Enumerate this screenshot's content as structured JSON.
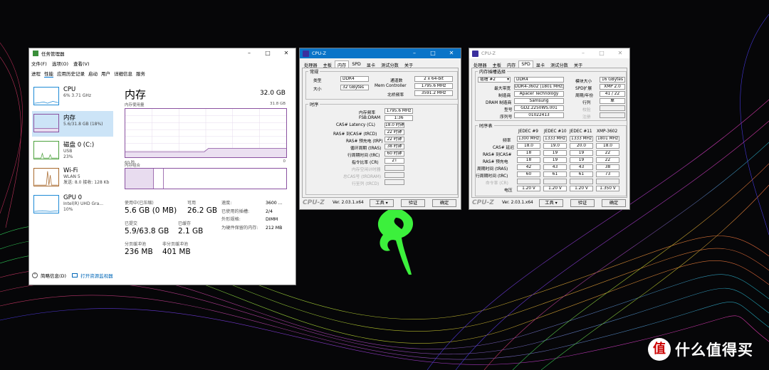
{
  "colors": {
    "mem_purple": "#8b52a1",
    "cpuz_blue": "#0a74c8",
    "select_blue": "#cce4f7"
  },
  "tm": {
    "title": "任务管理器",
    "menu": [
      "文件(F)",
      "选项(O)",
      "查看(V)"
    ],
    "tabs": [
      "进程",
      "性能",
      "应用历史记录",
      "启动",
      "用户",
      "详细信息",
      "服务"
    ],
    "side": [
      {
        "t": "CPU",
        "d1": "6%  3.71 GHz",
        "d2": ""
      },
      {
        "t": "内存",
        "d1": "5.6/31.8 GB (18%)",
        "d2": ""
      },
      {
        "t": "磁盘 0 (C:)",
        "d1": "USB",
        "d2": "23%"
      },
      {
        "t": "Wi-Fi",
        "d1": "WLAN 5",
        "d2": "发送: 8.0  接收: 128 Kb"
      },
      {
        "t": "GPU 0",
        "d1": "Intel(R) UHD Gra...",
        "d2": "10%"
      }
    ],
    "main": {
      "title": "内存",
      "total": "32.0 GB",
      "usage_label": "内存使用量",
      "usage_max": "31.8 GB",
      "axis_left": "60 秒",
      "axis_right": "0",
      "comp_label": "内存组合"
    },
    "stats": {
      "inuse_l": "使用中(已压缩)",
      "inuse_v": "5.6 GB (0 MB)",
      "avail_l": "可用",
      "avail_v": "26.2 GB",
      "commit_l": "已提交",
      "commit_v": "5.9/63.8 GB",
      "cache_l": "已缓存",
      "cache_v": "2.1 GB",
      "paged_l": "分页缓冲池",
      "paged_v": "236 MB",
      "np_l": "非分页缓冲池",
      "np_v": "401 MB"
    },
    "kv": [
      [
        "速度:",
        "3600 ..."
      ],
      [
        "已使用的插槽:",
        "2/4"
      ],
      [
        "外形规格:",
        "DIMM"
      ],
      [
        "为硬件保留的内存:",
        "212 MB"
      ]
    ],
    "footer": {
      "brief": "简略信息(D)",
      "open": "打开资源监视器"
    }
  },
  "cz1": {
    "title": "CPU-Z",
    "tabs": [
      "处理器",
      "主板",
      "内存",
      "SPD",
      "显卡",
      "测试分数",
      "关于"
    ],
    "general": "常规",
    "type_l": "类型",
    "type_v": "DDR4",
    "size_l": "大小",
    "size_v": "32 GBytes",
    "ch_l": "通道数",
    "ch_v": "2 x 64-bit",
    "mc_l": "Mem Controller",
    "mc_v": "1795.6 MHz",
    "nb_l": "北桥频率",
    "nb_v": "3591.2 MHz",
    "timing": "时序",
    "rows": [
      [
        "内存频率",
        "1795.6 MHz"
      ],
      [
        "FSB:DRAM",
        "1:36"
      ],
      [
        "CAS# Latency (CL)",
        "18.0 时钟"
      ],
      [
        "RAS# 到CAS# (tRCD)",
        "22 时钟"
      ],
      [
        "RAS# 预充电 (tRP)",
        "22 时钟"
      ],
      [
        "循环周期 (tRAS)",
        "38 时钟"
      ],
      [
        "行周期时间 (tRC)",
        "60 时钟"
      ],
      [
        "指令比率 (CR)",
        "2T"
      ]
    ],
    "gray": [
      "内存空闲计时器",
      "总CAS号 (tRDRAM)",
      "行至列 (tRCD)"
    ],
    "brand": "CPU-Z",
    "ver": "Ver. 2.03.1.x64",
    "tools": "工具",
    "verify": "验证",
    "ok": "确定"
  },
  "cz2": {
    "title": "CPU-Z",
    "tabs": [
      "处理器",
      "主板",
      "内存",
      "SPD",
      "显卡",
      "测试分数",
      "关于"
    ],
    "slotsel": "内存插槽选择",
    "slot": "插槽 #2",
    "slot_type": "DDR4",
    "modsize_l": "模块大小",
    "modsize_v": "16 GBytes",
    "maxbw_l": "最大带宽",
    "maxbw_v": "DDR4-3602 (1801 MHz)",
    "spd_l": "SPD扩展",
    "spd_v": "XMP 2.0",
    "mfr_l": "制造商",
    "mfr_v": "Apacer Technology",
    "week_l": "周期/年份",
    "week_v": "41 / 22",
    "dram_l": "DRAM 制造商",
    "dram_v": "Samsung",
    "rank_l": "行列",
    "rank_v": "单",
    "pn_l": "型号",
    "pn_v": "GD2.2250WS.001",
    "chk_l": "校验",
    "sn_l": "序列号",
    "sn_v": "01022413",
    "reg_l": "注册",
    "tt": "时序表",
    "cols": [
      "JEDEC #9",
      "JEDEC #10",
      "JEDEC #11",
      "XMP-3602"
    ],
    "trows": [
      [
        "频率",
        "1300 MHz",
        "1333 MHz",
        "1333 MHz",
        "1801 MHz"
      ],
      [
        "CAS# 延迟",
        "18.0",
        "19.0",
        "20.0",
        "18.0"
      ],
      [
        "RAS# 到CAS#",
        "18",
        "19",
        "19",
        "22"
      ],
      [
        "RAS# 预充电",
        "18",
        "19",
        "19",
        "22"
      ],
      [
        "周期时间 (tRAS)",
        "42",
        "43",
        "43",
        "38"
      ],
      [
        "行周期时间 (tRC)",
        "60",
        "61",
        "61",
        "73"
      ],
      [
        "命令率 (CR)",
        "",
        "",
        "",
        ""
      ],
      [
        "电压",
        "1.20 V",
        "1.20 V",
        "1.20 V",
        "1.350 V"
      ]
    ],
    "brand": "CPU-Z",
    "ver": "Ver. 2.03.1.x64",
    "tools": "工具",
    "verify": "验证",
    "ok": "确定"
  },
  "watermark": {
    "glyph": "值",
    "text": "什么值得买"
  }
}
